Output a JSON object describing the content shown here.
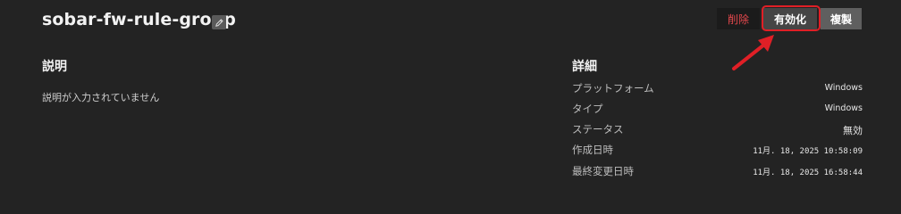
{
  "header": {
    "title": "sobar-fw-rule-group"
  },
  "actions": {
    "delete_label": "削除",
    "enable_label": "有効化",
    "copy_label": "複製"
  },
  "description": {
    "title": "説明",
    "text": "説明が入力されていません"
  },
  "details": {
    "title": "詳細",
    "rows": [
      {
        "label": "プラットフォーム",
        "value": "Windows"
      },
      {
        "label": "タイプ",
        "value": "Windows"
      },
      {
        "label": "ステータス",
        "value": "無効"
      },
      {
        "label": "作成日時",
        "value": "11月. 18, 2025 10:58:09"
      },
      {
        "label": "最終変更日時",
        "value": "11月. 18, 2025 16:58:44"
      }
    ]
  },
  "colors": {
    "background": "#232323",
    "delete_text": "#e5484d",
    "highlight_annotation": "#e01f26"
  },
  "icons": {
    "edit": "pencil-icon",
    "annotation": "red-arrow"
  }
}
